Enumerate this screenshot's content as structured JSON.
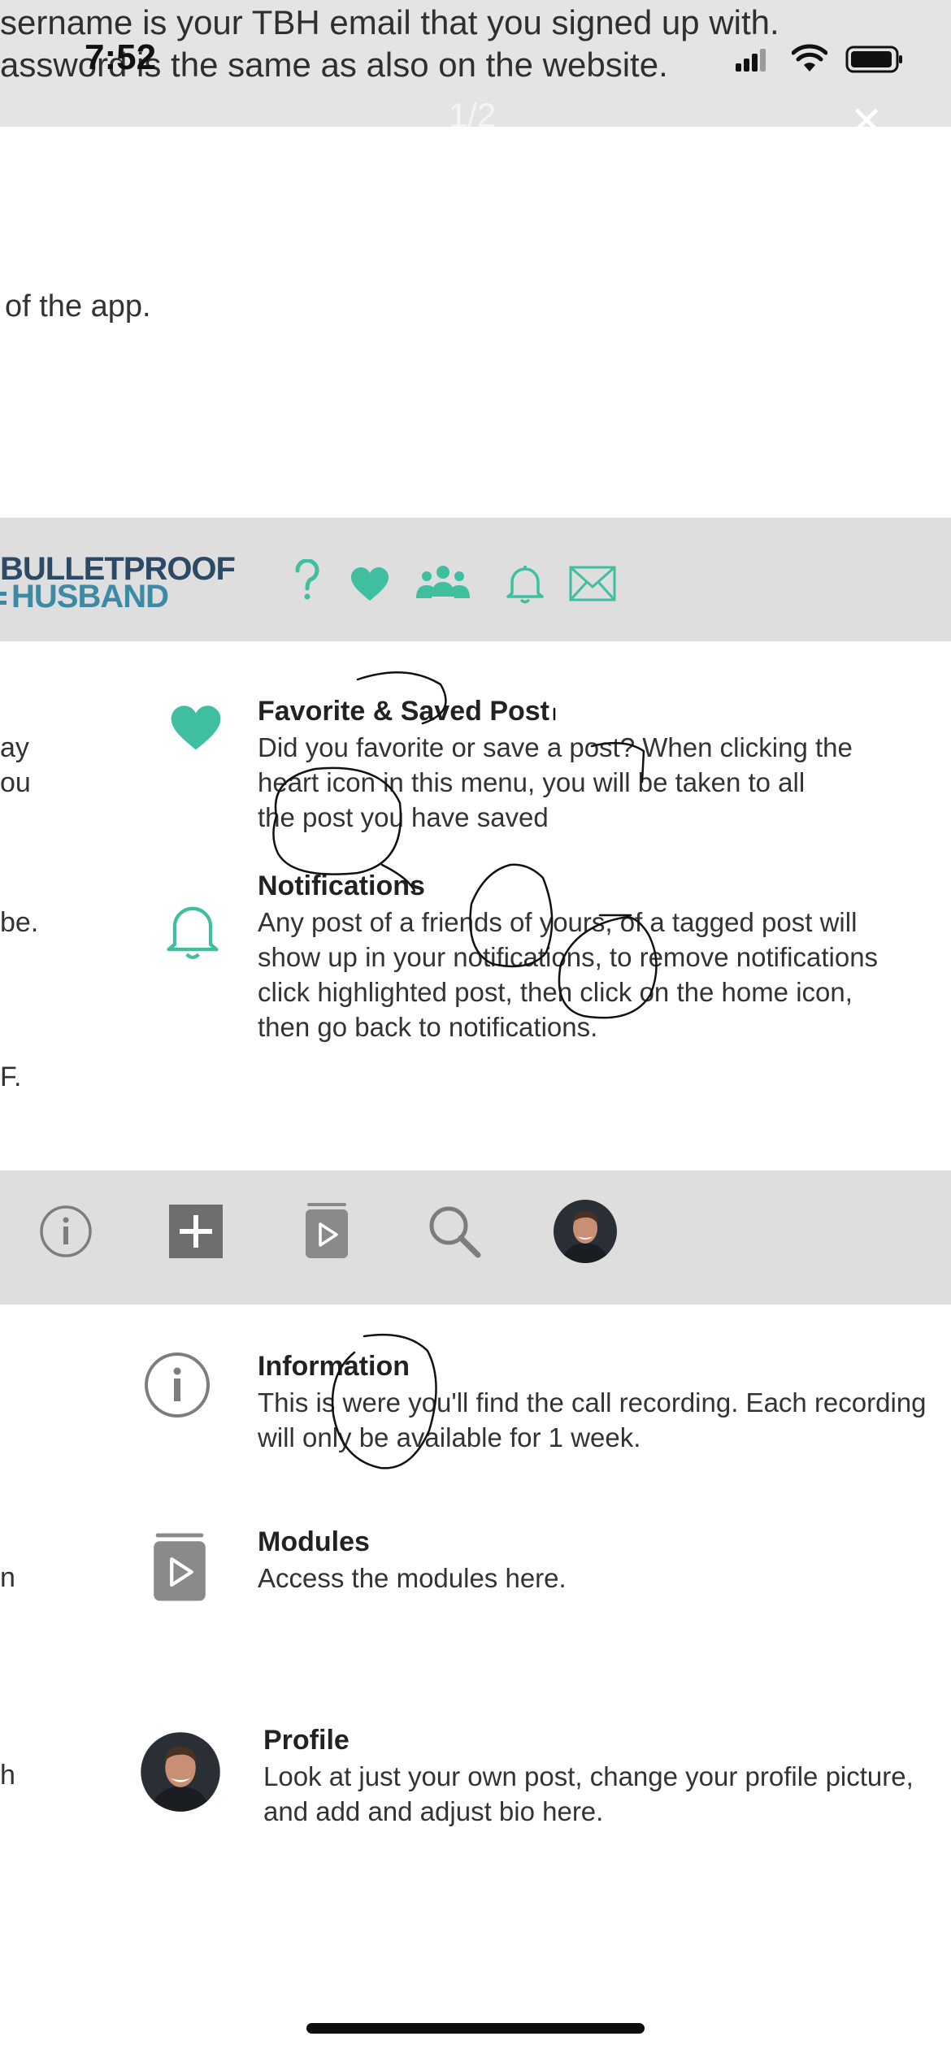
{
  "status_bar": {
    "time": "7:52"
  },
  "viewer": {
    "page_counter": "1/2",
    "close_symbol": "✕"
  },
  "intro": {
    "line1": "sername is your TBH email that you signed up with.",
    "line2": "assword is the same as also on the website.",
    "line3": "of the app."
  },
  "brand": {
    "line1": "BULLETPROOF",
    "line2": "HUSBAND"
  },
  "nav_icons_top": [
    "help-icon",
    "heart-icon",
    "community-icon",
    "bell-icon",
    "mail-icon"
  ],
  "nav_icons_bottom": [
    "info-icon",
    "plus-icon",
    "modules-icon",
    "search-icon",
    "profile-avatar"
  ],
  "left_fragments": {
    "f1": "ay",
    "f2": "ou",
    "f3": "be.",
    "f4": "F.",
    "f5": "n",
    "f6": "h"
  },
  "items": [
    {
      "icon": "heart-icon",
      "title": "Favorite & Saved Post",
      "lines": [
        "Did you favorite or save a post? When clicking the",
        "heart icon in this menu, you will be taken to all",
        "the post you have saved"
      ]
    },
    {
      "icon": "bell-icon",
      "title": "Notifications",
      "lines": [
        "Any post of a friends of yours, of a tagged post will",
        "show up in your notifications, to remove notifications",
        "click highlighted post, then click on the home icon,",
        "then go back to notifications."
      ]
    },
    {
      "icon": "info-icon",
      "title": "Information",
      "lines": [
        "This is were you'll find the call recording.  Each recording",
        "will only be available for 1 week."
      ]
    },
    {
      "icon": "modules-icon",
      "title": "Modules",
      "lines": [
        "Access the modules here."
      ]
    },
    {
      "icon": "profile-avatar",
      "title": "Profile",
      "lines": [
        "Look at just your own post, change your profile picture,",
        "and add and adjust bio here."
      ]
    }
  ],
  "colors": {
    "teal": "#3fbf9f",
    "gray_icon": "#7d7d7d",
    "band": "#dedede",
    "brand_dark": "#2c4a66",
    "brand_light": "#3d8aa7"
  }
}
